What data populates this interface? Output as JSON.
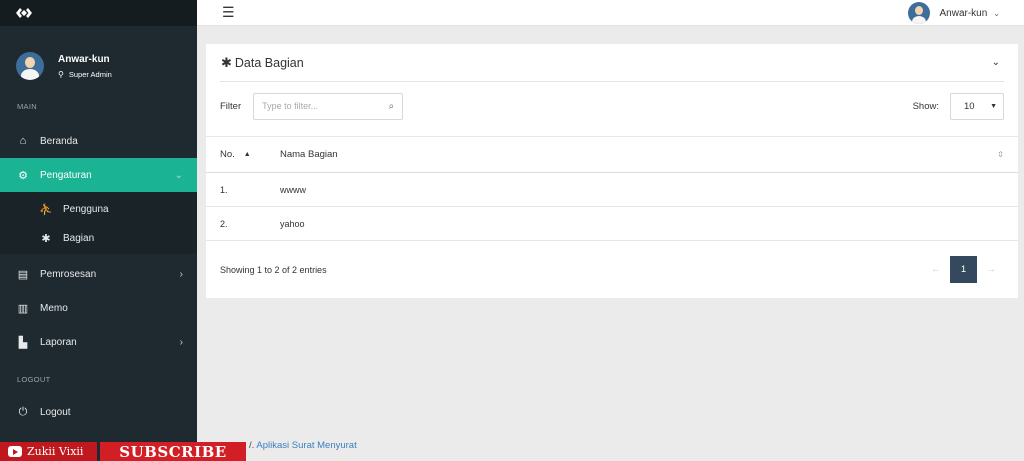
{
  "topbar": {
    "menu_icon": "hamburger-icon",
    "user_name": "Anwar-kun",
    "caret": "⌄"
  },
  "sidebar": {
    "user_name": "Anwar-kun",
    "user_role": "Super Admin",
    "section_main": "MAIN",
    "section_logout": "LOGOUT",
    "items": {
      "beranda": "Beranda",
      "pengaturan": "Pengaturan",
      "pengguna": "Pengguna",
      "bagian": "Bagian",
      "pemrosesan": "Pemrosesan",
      "memo": "Memo",
      "laporan": "Laporan",
      "logout": "Logout"
    },
    "accent_color": "#1ab394"
  },
  "panel": {
    "title": "Data Bagian",
    "filter_label": "Filter",
    "filter_placeholder": "Type to filter...",
    "show_label": "Show:",
    "show_value": "10",
    "columns": [
      "No.",
      "Nama Bagian"
    ],
    "rows": [
      {
        "no": "1.",
        "nama": "wwww"
      },
      {
        "no": "2.",
        "nama": "yahoo"
      }
    ],
    "info": "Showing 1 to 2 of 2 entries",
    "current_page": "1",
    "prev": "←",
    "next": "→"
  },
  "footer": {
    "prefix": "/.",
    "link": "Aplikasi Surat Menyurat"
  },
  "overlay": {
    "channel": "Zukii Vixii",
    "subscribe": "SUBSCRIBE"
  }
}
